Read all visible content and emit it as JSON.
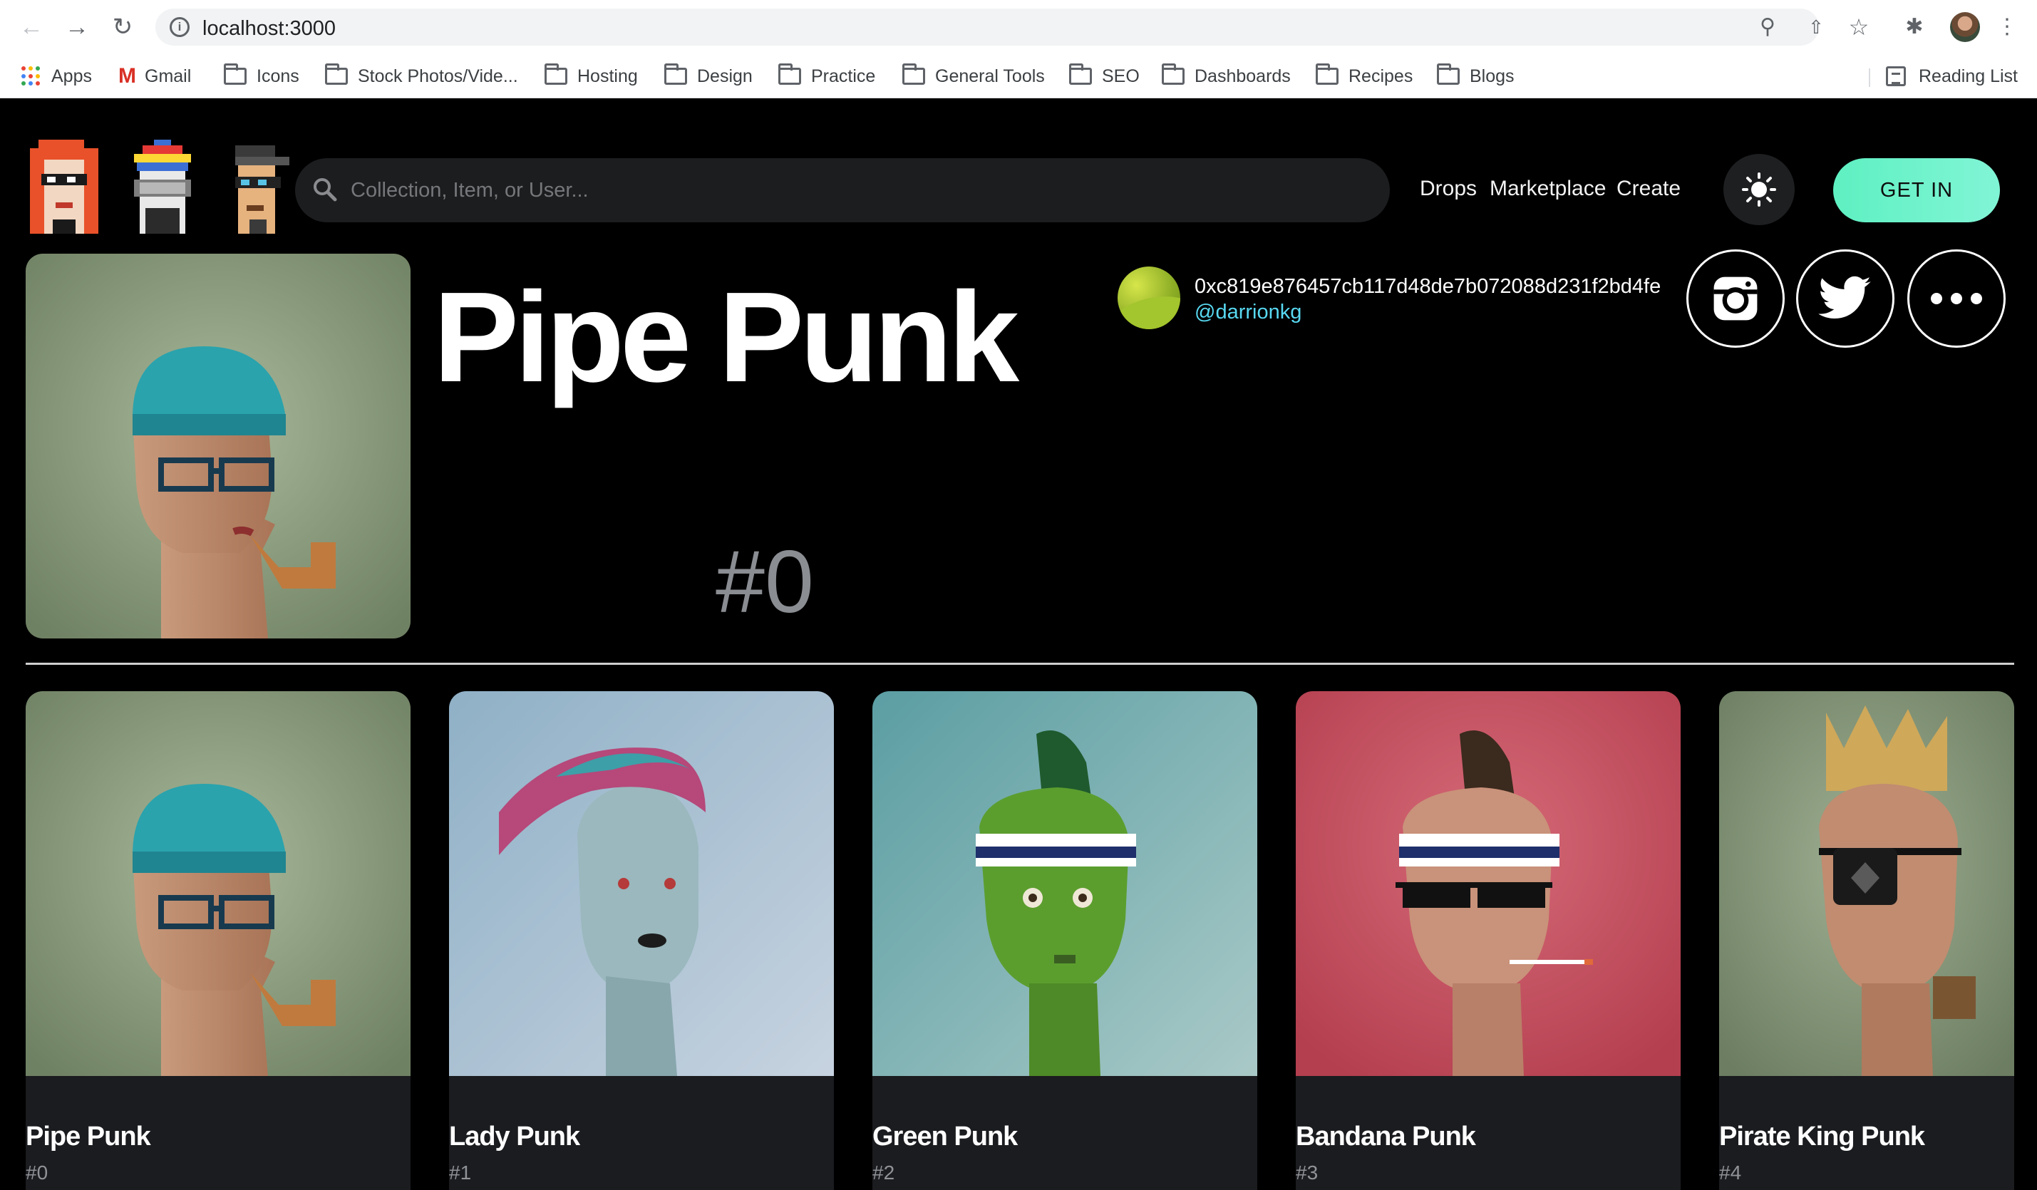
{
  "browser": {
    "url": "localhost:3000",
    "bookmarks": [
      {
        "label": "Apps",
        "icon": "apps-icon"
      },
      {
        "label": "Gmail",
        "icon": "gmail-icon"
      },
      {
        "label": "Icons",
        "icon": "folder-icon"
      },
      {
        "label": "Stock Photos/Vide...",
        "icon": "folder-icon"
      },
      {
        "label": "Hosting",
        "icon": "folder-icon"
      },
      {
        "label": "Design",
        "icon": "folder-icon"
      },
      {
        "label": "Practice",
        "icon": "folder-icon"
      },
      {
        "label": "General Tools",
        "icon": "folder-icon"
      },
      {
        "label": "SEO",
        "icon": "folder-icon"
      },
      {
        "label": "Dashboards",
        "icon": "folder-icon"
      },
      {
        "label": "Recipes",
        "icon": "folder-icon"
      },
      {
        "label": "Blogs",
        "icon": "folder-icon"
      }
    ],
    "reading_list": "Reading List"
  },
  "header": {
    "search_placeholder": "Collection, Item, or User...",
    "nav": [
      "Drops",
      "Marketplace",
      "Create"
    ],
    "cta": "GET IN",
    "accent": "#5ef0c1"
  },
  "hero": {
    "title": "Pipe Punk",
    "number": "#0",
    "owner_address": "0xc819e876457cb117d48de7b072088d231f2bd4fe",
    "owner_handle": "@darrionkg",
    "handle_color": "#58d9f2"
  },
  "cards": [
    {
      "name": "Pipe Punk",
      "number": "#0"
    },
    {
      "name": "Lady Punk",
      "number": "#1"
    },
    {
      "name": "Green Punk",
      "number": "#2"
    },
    {
      "name": "Bandana Punk",
      "number": "#3"
    },
    {
      "name": "Pirate King Punk",
      "number": "#4"
    }
  ]
}
